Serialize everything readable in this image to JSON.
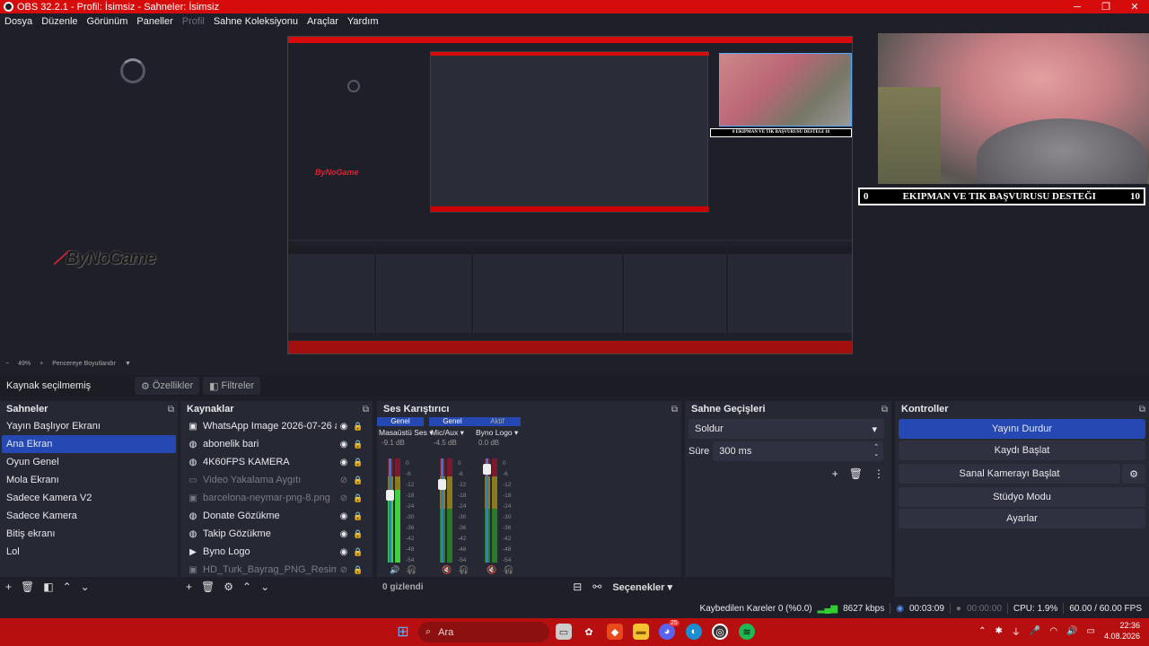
{
  "window": {
    "title": "OBS 32.2.1 - Profil: İsimsiz - Sahneler: İsimsiz",
    "minimize": "─",
    "maximize": "❐",
    "close": "✕"
  },
  "menu": [
    "Dosya",
    "Düzenle",
    "Görünüm",
    "Paneller",
    "Profil",
    "Sahne Koleksiyonu",
    "Araçlar",
    "Yardım"
  ],
  "preview": {
    "logo_text": "ByNoGame",
    "lower_third": {
      "left": "0",
      "text": "EKIPMAN VE TIK BAŞVURUSU DESTEĞI",
      "right": "10"
    },
    "nested_lower_third": "0     EKIPMAN VE TIK BAŞVURUSU DESTEĞI     10",
    "zoom": {
      "minus": "−",
      "value": "49%",
      "plus": "+",
      "fit": "Pencereye Boyutlandır"
    }
  },
  "source_toolbar": {
    "status": "Kaynak seçilmemiş",
    "properties": "Özellikler",
    "filters": "Filtreler"
  },
  "scenes": {
    "title": "Sahneler",
    "items": [
      "Yayın Başlıyor Ekranı",
      "Ana Ekran",
      "Oyun Genel",
      "Mola Ekranı",
      "Sadece Kamera V2",
      "Sadece Kamera",
      "Bitiş ekranı",
      "Lol"
    ],
    "selected_index": 1
  },
  "sources": {
    "title": "Kaynaklar",
    "items": [
      {
        "name": "WhatsApp Image 2026-07-26 at 03.48",
        "icon": "image-icon",
        "visible": true
      },
      {
        "name": "abonelik bari",
        "icon": "browser-icon",
        "visible": true
      },
      {
        "name": "4K60FPS KAMERA",
        "icon": "browser-icon",
        "visible": true
      },
      {
        "name": "Video Yakalama Aygıtı",
        "icon": "camera-icon",
        "visible": false
      },
      {
        "name": "barcelona-neymar-png-8.png",
        "icon": "image-icon",
        "visible": false
      },
      {
        "name": "Donate Gözükme",
        "icon": "browser-icon",
        "visible": true
      },
      {
        "name": "Takip Gözükme",
        "icon": "browser-icon",
        "visible": true
      },
      {
        "name": "Byno Logo",
        "icon": "media-icon",
        "visible": true
      },
      {
        "name": "HD_Turk_Bayrag_PNG_Resimleri__Tı",
        "icon": "image-icon",
        "visible": false
      }
    ]
  },
  "mixer": {
    "title": "Ses Karıştırıcı",
    "channels": [
      {
        "tag": "Genel",
        "name": "Masaüstü Ses",
        "db": "-9.1 dB",
        "level": 0.7,
        "fader": 0.7,
        "muted": false
      },
      {
        "tag": "Genel",
        "name": "Mic/Aux",
        "db": "-4.5 dB",
        "level": 0.0,
        "fader": 0.8,
        "muted": true
      },
      {
        "tag": "Aktif",
        "name": "Byno Logo",
        "db": "0.0 dB",
        "level": 0.0,
        "fader": 0.95,
        "muted": true
      }
    ],
    "scale": [
      "0",
      "-6",
      "-12",
      "-18",
      "-24",
      "-30",
      "-36",
      "-42",
      "-48",
      "-54",
      "-60"
    ],
    "hidden_count": "0 gizlendi",
    "options": "Seçenekler"
  },
  "transitions": {
    "title": "Sahne Geçişleri",
    "selected": "Soldur",
    "duration_label": "Süre",
    "duration_value": "300 ms"
  },
  "controls": {
    "title": "Kontroller",
    "stop_stream": "Yayını Durdur",
    "start_record": "Kaydı Başlat",
    "virtual_cam": "Sanal Kamerayı Başlat",
    "studio_mode": "Stüdyo Modu",
    "settings": "Ayarlar"
  },
  "status": {
    "dropped": "Kaybedilen Kareler 0 (%0.0)",
    "bitrate": "8627 kbps",
    "stream_time": "00:03:09",
    "record_time": "00:00:00",
    "cpu": "CPU: 1.9%",
    "fps": "60.00 / 60.00 FPS"
  },
  "taskbar": {
    "search": "Ara",
    "time": "22:36",
    "date": "4.08.2026",
    "discord_badge": "25"
  },
  "colors": {
    "accent": "#2548b3",
    "red": "#d60c0c",
    "bg": "#1e1f29",
    "panel": "#262833"
  }
}
